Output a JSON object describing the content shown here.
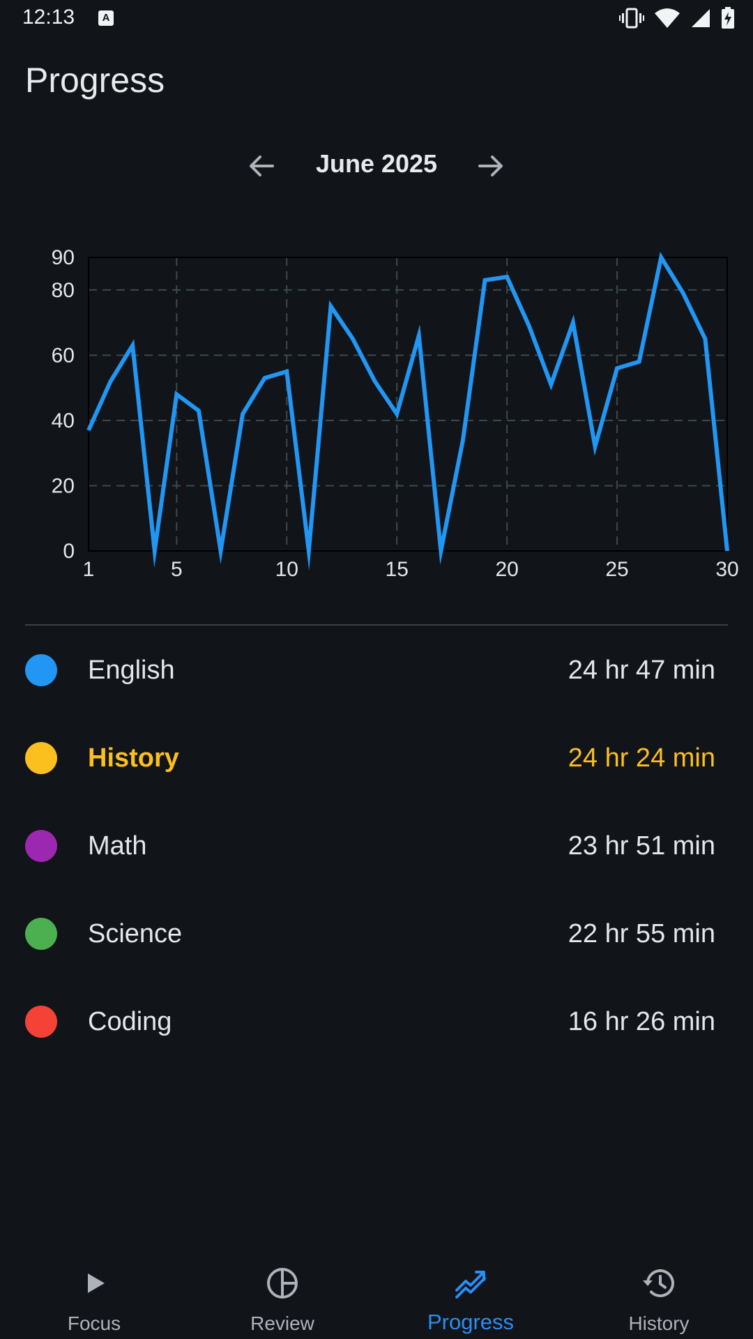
{
  "status_bar": {
    "time": "12:13",
    "notification_icon": "A",
    "icons": [
      "vibrate-icon",
      "wifi-icon",
      "signal-icon",
      "battery-charging-icon"
    ]
  },
  "header": {
    "title": "Progress"
  },
  "month_nav": {
    "label": "June 2025",
    "prev_icon": "arrow-left-icon",
    "next_icon": "arrow-right-icon"
  },
  "chart_data": {
    "type": "line",
    "x": [
      1,
      2,
      3,
      4,
      5,
      6,
      7,
      8,
      9,
      10,
      11,
      12,
      13,
      14,
      15,
      16,
      17,
      18,
      19,
      20,
      21,
      22,
      23,
      24,
      25,
      26,
      27,
      28,
      29,
      30
    ],
    "series": [
      {
        "values": [
          37,
          52,
          63,
          0,
          48,
          43,
          0,
          42,
          53,
          55,
          0,
          75,
          65,
          52,
          42,
          66,
          0,
          34,
          83,
          84,
          69,
          51,
          70,
          32,
          56,
          58,
          90,
          79,
          65,
          0
        ]
      }
    ],
    "xticks": [
      "1",
      "5",
      "10",
      "15",
      "20",
      "25",
      "30"
    ],
    "yticks": [
      "0",
      "20",
      "40",
      "60",
      "80",
      "90"
    ],
    "xlim": [
      1,
      30
    ],
    "ylim": [
      0,
      90
    ],
    "grid": "dashed",
    "colors": {
      "line": "#2196f3",
      "grid": "#3d4a50",
      "axis": "#000000",
      "tick": "#e6e7ea"
    }
  },
  "subjects": [
    {
      "name": "English",
      "time": "24 hr 47 min",
      "color": "#2196f3",
      "active": false
    },
    {
      "name": "History",
      "time": "24 hr 24 min",
      "color": "#fbbf1e",
      "active": true
    },
    {
      "name": "Math",
      "time": "23 hr 51 min",
      "color": "#9c27b0",
      "active": false
    },
    {
      "name": "Science",
      "time": "22 hr 55 min",
      "color": "#4caf50",
      "active": false
    },
    {
      "name": "Coding",
      "time": "16 hr 26 min",
      "color": "#f44336",
      "active": false
    }
  ],
  "bottom_nav": [
    {
      "label": "Focus",
      "icon": "play-icon",
      "active": false
    },
    {
      "label": "Review",
      "icon": "pie-chart-icon",
      "active": false
    },
    {
      "label": "Progress",
      "icon": "trending-up-icon",
      "active": true
    },
    {
      "label": "History",
      "icon": "history-icon",
      "active": false
    }
  ],
  "colors": {
    "background": "#111419",
    "accent": "#2a8ef2",
    "highlight": "#fbbf1e"
  }
}
